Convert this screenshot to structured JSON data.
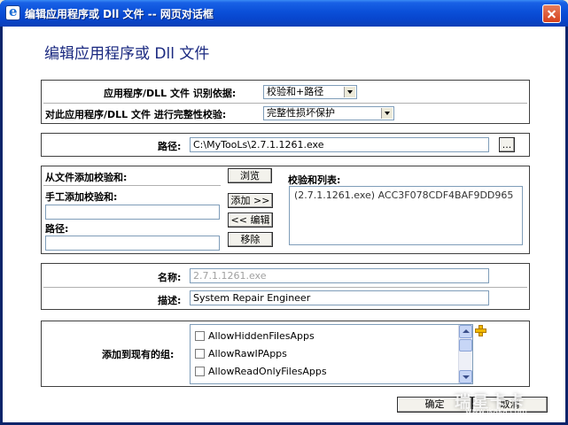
{
  "window": {
    "title": "编辑应用程序或 Dll 文件 -- 网页对话框"
  },
  "heading": "编辑应用程序或 Dll 文件",
  "identify": {
    "label": "应用程序/DLL 文件 识别依据:",
    "value": "校验和+路径"
  },
  "integrity": {
    "label": "对此应用程序/DLL 文件 进行完整性校验:",
    "value": "完整性损坏保护"
  },
  "path_row": {
    "label": "路径:",
    "value": "C:\\MyTooLs\\2.7.1.1261.exe",
    "browse_label": "..."
  },
  "checksum": {
    "from_file_label": "从文件添加校验和:",
    "browse_button": "浏览",
    "manual_label": "手工添加校验和:",
    "manual_value": "",
    "path_label": "路径:",
    "path_value": "",
    "add_button": "添加 >>",
    "edit_button": "<< 编辑",
    "remove_button": "移除",
    "list_label": "校验和列表:",
    "list_items": [
      "(2.7.1.1261.exe) ACC3F078CDF4BAF9DD965"
    ]
  },
  "details": {
    "name_label": "名称:",
    "name_value": "2.7.1.1261.exe",
    "desc_label": "描述:",
    "desc_value": "System Repair Engineer"
  },
  "groups": {
    "label": "添加到现有的组:",
    "items": [
      "AllowHiddenFilesApps",
      "AllowRawIPApps",
      "AllowReadOnlyFilesApps"
    ],
    "add_icon": "plus-icon"
  },
  "footer": {
    "ok_button": "确定",
    "cancel_button": "取消"
  },
  "watermark": {
    "text": "瑞星卡卡",
    "sub": "www.ikaka.com"
  },
  "colors": {
    "titlebar": "#0a4fd8",
    "heading": "#1a2980"
  }
}
